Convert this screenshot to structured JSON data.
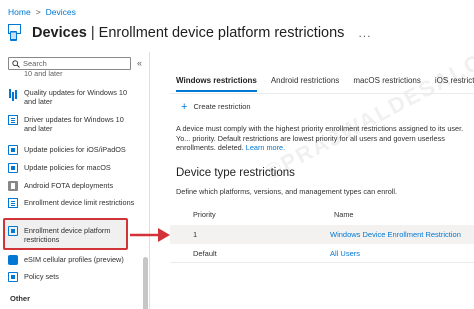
{
  "breadcrumb": {
    "home": "Home",
    "separator": ">",
    "current": "Devices"
  },
  "header": {
    "title_bold": "Devices",
    "title_rest": " | Enrollment device platform restrictions",
    "more": "..."
  },
  "sidebar": {
    "search_placeholder": "Search",
    "collapse": "«",
    "items": [
      {
        "label": "10 and later",
        "icon": "chart-icon"
      },
      {
        "label": "Quality updates for Windows 10 and later",
        "icon": "chart-icon"
      },
      {
        "label": "Driver updates for Windows 10 and later",
        "icon": "document-icon"
      },
      {
        "label": "Update policies for iOS/iPadOS",
        "icon": "device-icon"
      },
      {
        "label": "Update policies for macOS",
        "icon": "device-icon"
      },
      {
        "label": "Android FOTA deployments",
        "icon": "android-icon"
      },
      {
        "label": "Enrollment device limit restrictions",
        "icon": "document-icon"
      },
      {
        "label": "Enrollment device platform restrictions",
        "icon": "device-icon"
      },
      {
        "label": "eSIM cellular profiles (preview)",
        "icon": "sim-icon"
      },
      {
        "label": "Policy sets",
        "icon": "policy-icon"
      }
    ],
    "other_label": "Other"
  },
  "tabs": [
    "Windows restrictions",
    "Android restrictions",
    "macOS restrictions",
    "iOS restrictions"
  ],
  "create_label": "Create restriction",
  "description": {
    "text": "A device must comply with the highest priority enrollment restrictions assigned to its user. Yo... priority. Default restrictions are lowest priority for all users and govern userless enrollments. deleted.",
    "link": "Learn more."
  },
  "section": {
    "title": "Device type restrictions",
    "subtitle": "Define which platforms, versions, and management types can enroll."
  },
  "table": {
    "headers": {
      "priority": "Priority",
      "name": "Name"
    },
    "rows": [
      {
        "priority": "1",
        "name": "Windows Device Enrollment Restriction"
      },
      {
        "priority": "Default",
        "name": "All Users"
      }
    ]
  },
  "watermark": "©PRAJWALDESAI.COM",
  "colors": {
    "accent": "#0078d4",
    "highlight_border": "#d13438",
    "text": "#323130"
  }
}
